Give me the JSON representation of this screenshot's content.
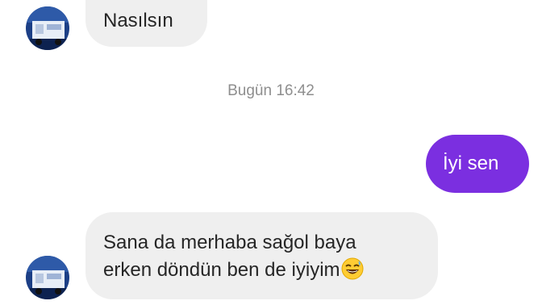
{
  "conversation": {
    "messages": [
      {
        "direction": "incoming",
        "text": "Nasılsın"
      },
      {
        "direction": "outgoing",
        "text": "İyi sen"
      },
      {
        "direction": "incoming",
        "lines": [
          "Sana da merhaba sağol baya",
          "erken döndün ben de iyiyim"
        ],
        "emoji": "laughing-face-with-sweat-icon"
      }
    ],
    "timestamp": "Bugün 16:42"
  },
  "colors": {
    "incoming_bubble": "#efefef",
    "outgoing_bubble": "#7b2fe0",
    "timestamp_text": "#8e8e8e"
  },
  "icons": {
    "avatar": "contact-avatar-icon"
  }
}
